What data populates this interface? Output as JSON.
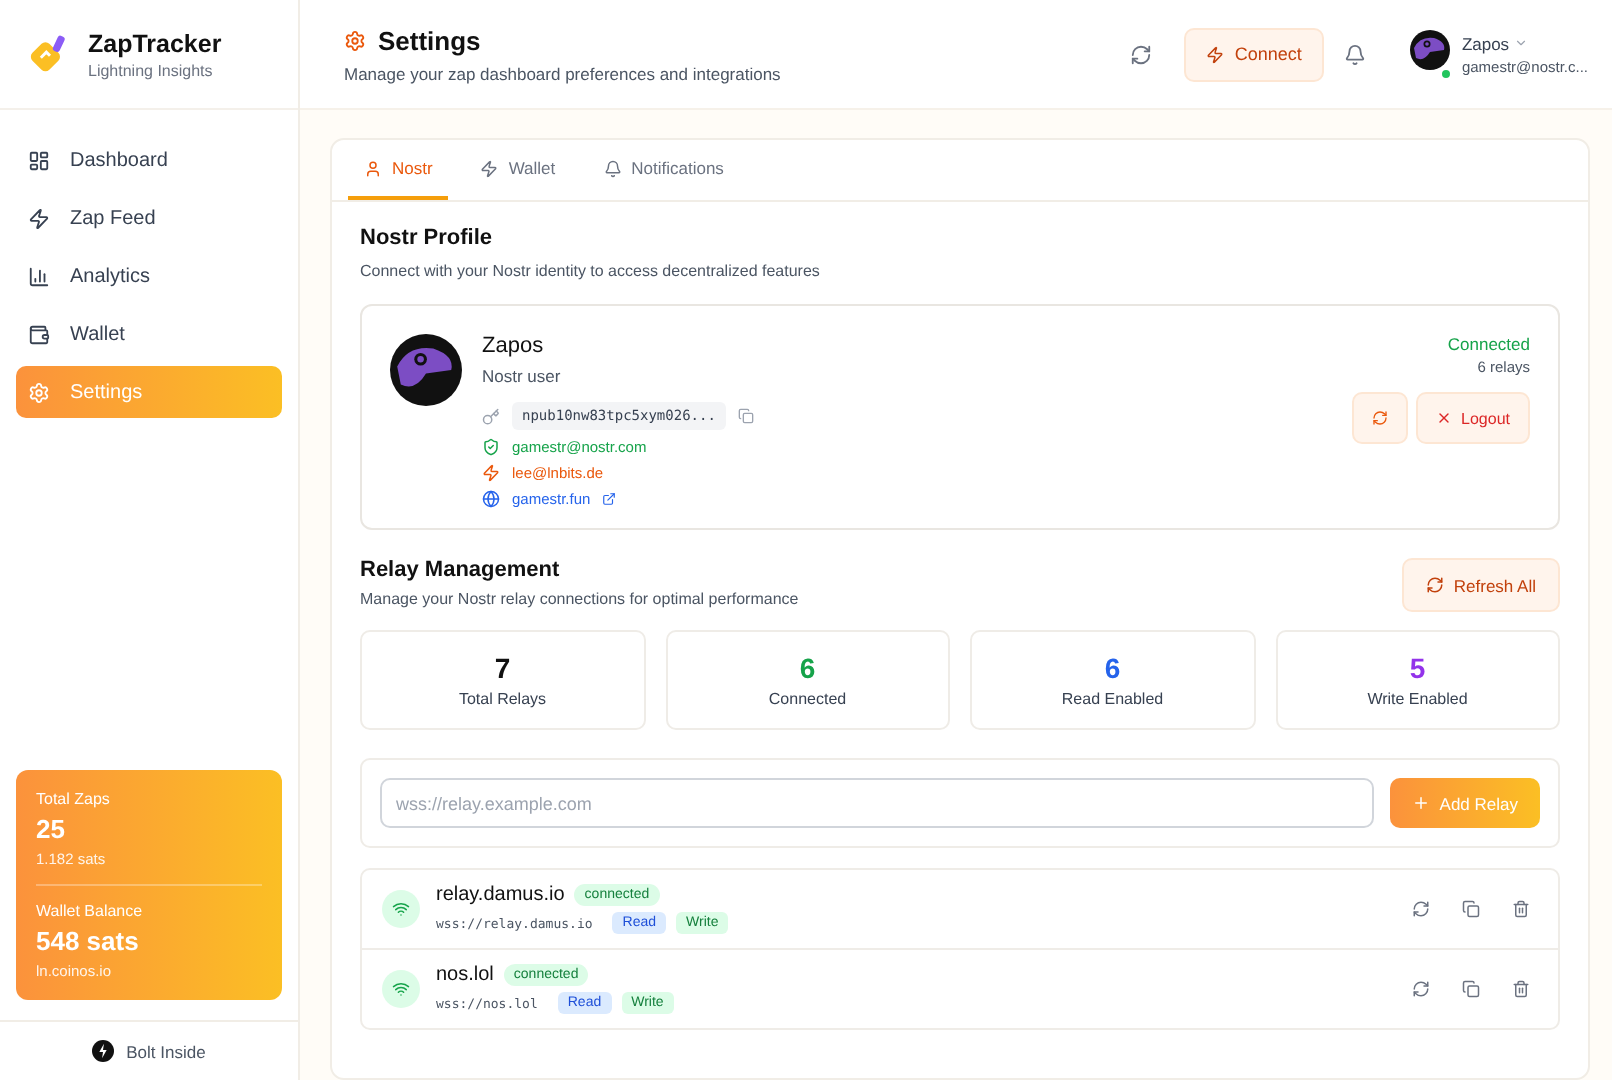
{
  "brand": {
    "name": "ZapTracker",
    "tagline": "Lightning Insights"
  },
  "sidebar": {
    "items": [
      {
        "label": "Dashboard",
        "selected": false
      },
      {
        "label": "Zap Feed",
        "selected": false
      },
      {
        "label": "Analytics",
        "selected": false
      },
      {
        "label": "Wallet",
        "selected": false
      },
      {
        "label": "Settings",
        "selected": true
      }
    ],
    "summary": {
      "total_label": "Total Zaps",
      "total_value": "25",
      "total_sats": "1.182 sats",
      "balance_label": "Wallet Balance",
      "balance_value": "548 sats",
      "balance_source": "ln.coinos.io"
    },
    "footer": "Bolt Inside"
  },
  "header": {
    "title": "Settings",
    "subtitle": "Manage your zap dashboard preferences and integrations",
    "connect_button": "Connect",
    "user": {
      "name": "Zapos",
      "email": "gamestr@nostr.c...",
      "online": true
    }
  },
  "tabs": [
    {
      "label": "Nostr",
      "selected": true
    },
    {
      "label": "Wallet",
      "selected": false
    },
    {
      "label": "Notifications",
      "selected": false
    }
  ],
  "profile": {
    "title": "Nostr Profile",
    "description": "Connect with your Nostr identity to access decentralized features",
    "name": "Zapos",
    "role": "Nostr user",
    "npub": "npub10nw83tpc5xym026...",
    "nip05": "gamestr@nostr.com",
    "lightning": "lee@lnbits.de",
    "website": "gamestr.fun",
    "status": "Connected",
    "relay_count": "6 relays",
    "logout_button": "Logout"
  },
  "relays": {
    "title": "Relay Management",
    "description": "Manage your Nostr relay connections for optimal performance",
    "refresh_button": "Refresh All",
    "stats": [
      {
        "value": "7",
        "label": "Total Relays",
        "color": "#111111"
      },
      {
        "value": "6",
        "label": "Connected",
        "color": "#16a34a"
      },
      {
        "value": "6",
        "label": "Read Enabled",
        "color": "#2563eb"
      },
      {
        "value": "5",
        "label": "Write Enabled",
        "color": "#9333ea"
      }
    ],
    "input": {
      "placeholder": "wss://relay.example.com"
    },
    "add_button": "Add Relay",
    "list": [
      {
        "name": "relay.damus.io",
        "status": "connected",
        "url": "wss://relay.damus.io",
        "tags": [
          {
            "label": "Read",
            "kind": "read"
          },
          {
            "label": "Write",
            "kind": "write"
          }
        ]
      },
      {
        "name": "nos.lol",
        "status": "connected",
        "url": "wss://nos.lol",
        "tags": [
          {
            "label": "Read",
            "kind": "read"
          },
          {
            "label": "Write",
            "kind": "write"
          }
        ]
      }
    ]
  }
}
